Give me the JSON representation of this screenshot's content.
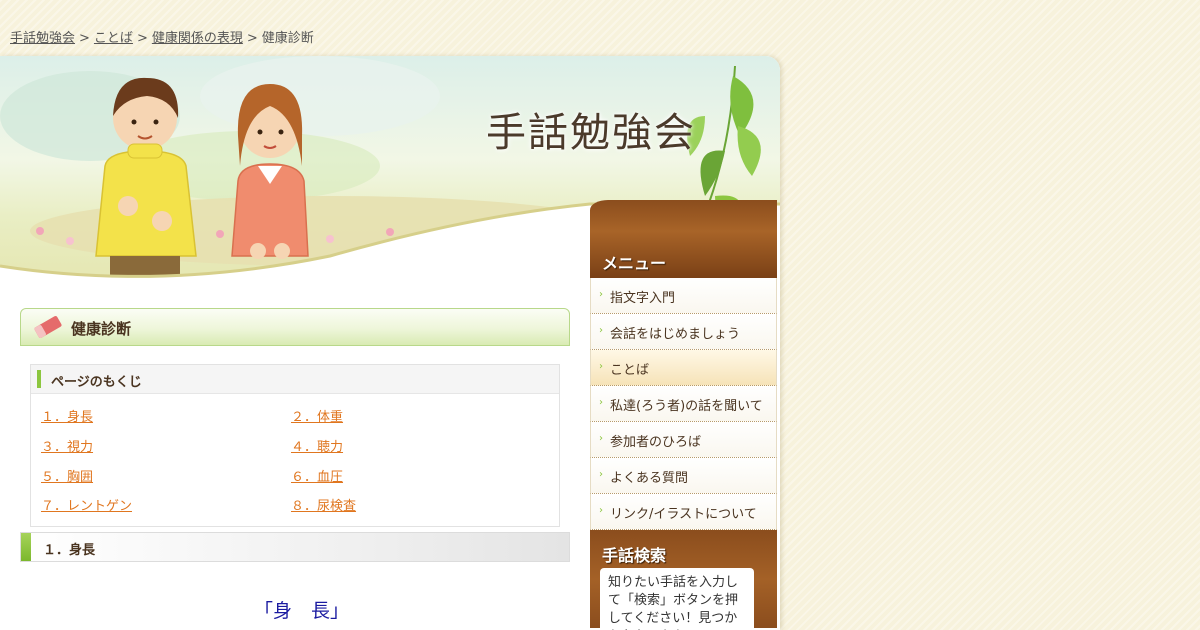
{
  "breadcrumb": {
    "items": [
      "手話勉強会",
      "ことば",
      "健康関係の表現"
    ],
    "current": "健康診断",
    "separator": ">"
  },
  "header": {
    "site_title": "手話勉強会"
  },
  "page": {
    "title": "健康診断"
  },
  "toc": {
    "heading": "ページのもくじ",
    "items": [
      "１．身長",
      "２．体重",
      "３．視力",
      "４．聴力",
      "５．胸囲",
      "６．血圧",
      "７．レントゲン",
      "８．尿検査"
    ]
  },
  "section": {
    "heading": "１．身長",
    "subheading": "「身　長」"
  },
  "sidebar": {
    "menu_heading": "メニュー",
    "items": [
      "指文字入門",
      "会話をはじめましょう",
      "ことば",
      "私達(ろう者)の話を聞いて",
      "参加者のひろば",
      "よくある質問",
      "リンク/イラストについて"
    ],
    "active_item": "ことば",
    "search_heading": "手話検索",
    "search_text": "知りたい手話を入力して「検索」ボタンを押してください！見つからなかったら"
  },
  "colors": {
    "accent_green": "#8cc63f",
    "menu_brown": "#8b4d1d",
    "link_orange": "#e0761f",
    "text_brown": "#4a3420"
  },
  "icons": [
    "eraser-icon",
    "menu-arrow-icon"
  ]
}
